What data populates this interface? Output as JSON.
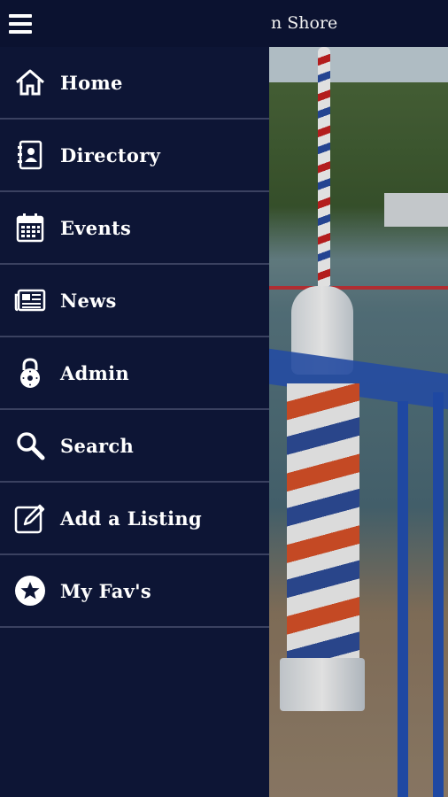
{
  "header": {
    "title": "n Shore",
    "menu_icon": "hamburger-menu-icon"
  },
  "drawer": {
    "items": [
      {
        "label": "Home",
        "icon": "home-icon"
      },
      {
        "label": "Directory",
        "icon": "directory-icon"
      },
      {
        "label": "Events",
        "icon": "calendar-icon"
      },
      {
        "label": "News",
        "icon": "newspaper-icon"
      },
      {
        "label": "Admin",
        "icon": "lock-icon"
      },
      {
        "label": "Search",
        "icon": "search-icon"
      },
      {
        "label": "Add a Listing",
        "icon": "edit-icon"
      },
      {
        "label": "My Fav's",
        "icon": "star-icon"
      }
    ]
  },
  "colors": {
    "drawer_bg": "#0d1535",
    "topbar_bg": "#0b1230",
    "divider": "#3a4160",
    "text": "#ffffff"
  },
  "background": {
    "image": "barber-pole-lighthouse-photo"
  }
}
